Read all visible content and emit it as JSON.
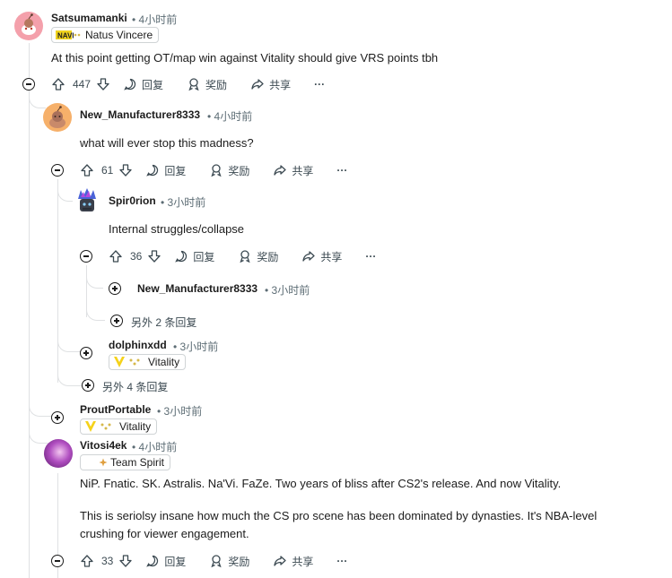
{
  "comments": {
    "c1": {
      "username": "Satsumamanki",
      "time": "4小时前",
      "flair": "Natus Vincere",
      "flair_icon": "navi-logo",
      "text": "At this point getting OT/map win against Vitality should give VRS points tbh",
      "votes": "447",
      "reply": "回复",
      "award": "奖励",
      "share": "共享",
      "more": "···",
      "avatar_color": "#f4a0ab"
    },
    "c2": {
      "username": "New_Manufacturer8333",
      "time": "4小时前",
      "text": "what will ever stop this madness?",
      "votes": "61",
      "reply": "回复",
      "award": "奖励",
      "share": "共享",
      "more": "···",
      "avatar_color": "#f6b06a"
    },
    "c3": {
      "username": "Spir0rion",
      "time": "3小时前",
      "text": "Internal struggles/collapse",
      "votes": "36",
      "reply": "回复",
      "award": "奖励",
      "share": "共享",
      "more": "···"
    },
    "c4": {
      "username": "New_Manufacturer8333",
      "time": "3小时前"
    },
    "more1": "另外 2 条回复",
    "c5": {
      "username": "dolphinxdd",
      "time": "3小时前",
      "flair": "Vitality",
      "flair_icon": "vitality-logo"
    },
    "more2": "另外 4 条回复",
    "c6": {
      "username": "ProutPortable",
      "time": "3小时前",
      "flair": "Vitality",
      "flair_icon": "vitality-logo"
    },
    "c7": {
      "username": "Vitosi4ek",
      "time": "4小时前",
      "flair": "Team Spirit",
      "flair_icon": "team-spirit-logo",
      "text1": "NiP. Fnatic. SK. Astralis. Na'Vi. FaZe. Two years of bliss after CS2's release. And now Vitality.",
      "text2": "This is seriolsy insane how much the CS pro scene has been dominated by dynasties. It's NBA-level",
      "text3": "crushing for viewer engagement.",
      "votes": "33",
      "reply": "回复",
      "award": "奖励",
      "share": "共享",
      "more": "···"
    }
  },
  "separator": "•",
  "colors": {
    "thread_line": "#dfe1e3",
    "vitality_yellow": "#f5d21a",
    "navi_yellow": "#f0d31c"
  }
}
